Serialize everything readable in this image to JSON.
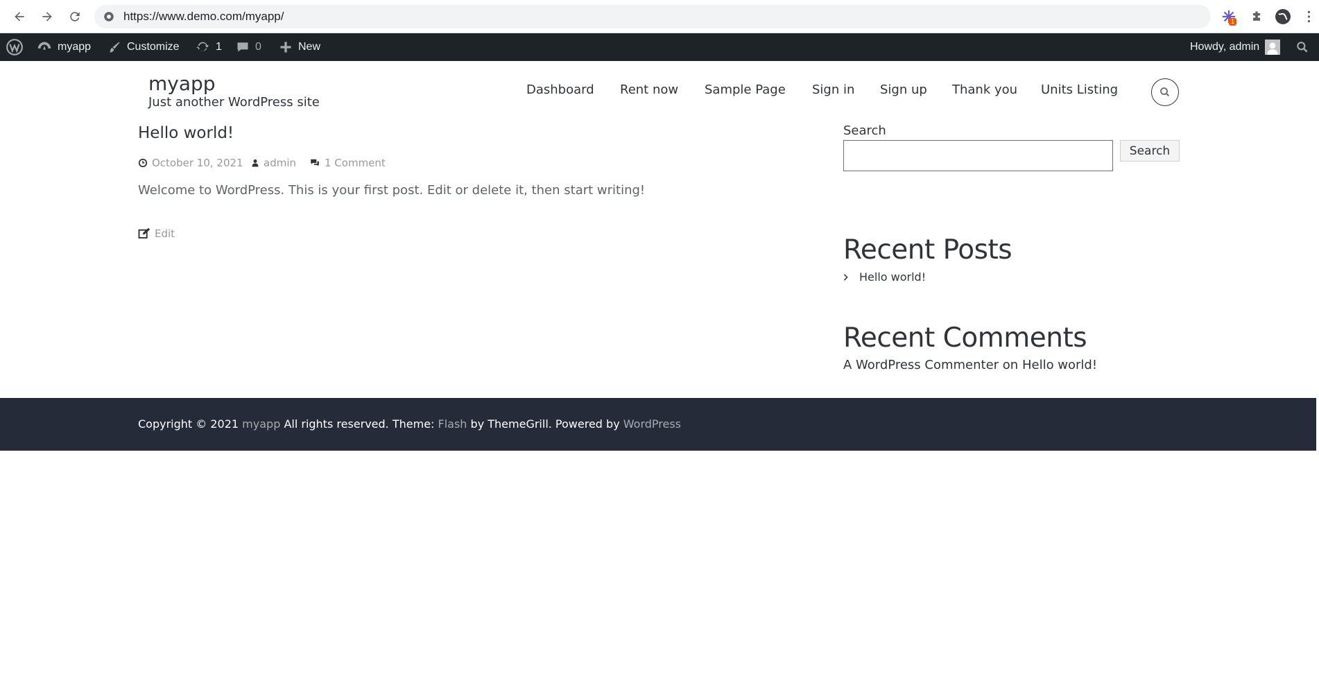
{
  "browser": {
    "url": "https://www.demo.com/myapp/",
    "extension_badge": "1"
  },
  "adminbar": {
    "site_name": "myapp",
    "customize": "Customize",
    "updates_count": "1",
    "comments_count": "0",
    "new_label": "New",
    "howdy": "Howdy, admin",
    "bg_color": "#1d2327"
  },
  "header": {
    "site_title": "myapp",
    "tagline": "Just another WordPress site",
    "menu": [
      "Dashboard",
      "Rent now",
      "Sample Page",
      "Sign in",
      "Sign up",
      "Thank you",
      "Units Listing"
    ]
  },
  "post": {
    "title": "Hello world!",
    "date": "October 10, 2021",
    "author": "admin",
    "comments": "1 Comment",
    "excerpt": "Welcome to WordPress. This is your first post. Edit or delete it, then start writing!",
    "edit_label": "Edit"
  },
  "sidebar": {
    "search_label": "Search",
    "search_button": "Search",
    "search_value": "",
    "recent_posts_title": "Recent Posts",
    "recent_posts": [
      "Hello world!"
    ],
    "recent_comments_title": "Recent Comments",
    "comment_author": "A WordPress Commenter",
    "comment_on": "on",
    "comment_post": "Hello world!"
  },
  "footer": {
    "copyright": "Copyright © 2021",
    "site_link": "myapp",
    "rights": "All rights reserved. Theme:",
    "theme_link": "Flash",
    "by": "by ThemeGrill. Powered by",
    "wp_link": "WordPress",
    "bg_color": "#262b3a"
  }
}
